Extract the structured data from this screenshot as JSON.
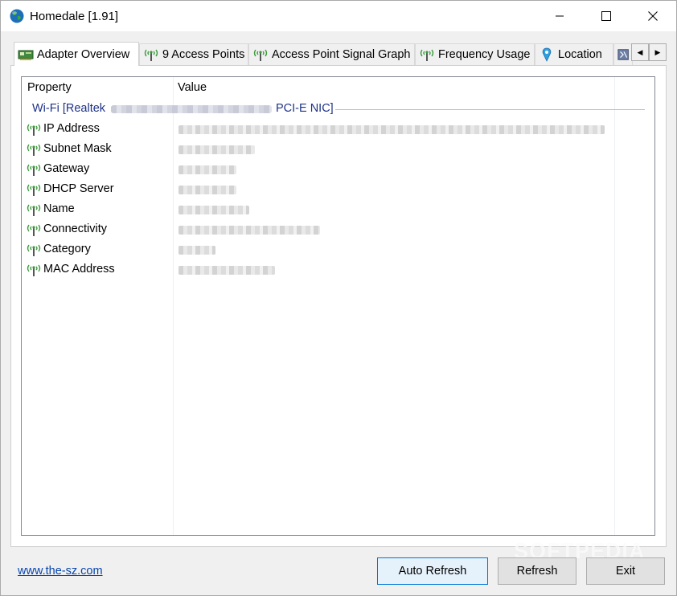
{
  "window": {
    "title": "Homedale [1.91]",
    "icon": "globe-icon"
  },
  "tabs": [
    {
      "label": "Adapter Overview",
      "icon": "network-card-icon",
      "active": true
    },
    {
      "label": "9 Access Points",
      "icon": "antenna-icon"
    },
    {
      "label": "Access Point Signal Graph",
      "icon": "antenna-icon"
    },
    {
      "label": "Frequency Usage",
      "icon": "antenna-icon"
    },
    {
      "label": "Location",
      "icon": "map-pin-icon"
    },
    {
      "label": "",
      "icon": "misc-tab-icon"
    }
  ],
  "tab_scroll": {
    "left_glyph": "◀",
    "right_glyph": "▶"
  },
  "list": {
    "columns": [
      "Property",
      "Value"
    ],
    "group": {
      "prefix": "Wi-Fi [Realtek",
      "suffix": "PCI-E NIC]"
    },
    "rows": [
      {
        "property": "IP Address",
        "icon": "antenna-icon"
      },
      {
        "property": "Subnet Mask",
        "icon": "antenna-icon"
      },
      {
        "property": "Gateway",
        "icon": "antenna-icon"
      },
      {
        "property": "DHCP Server",
        "icon": "antenna-icon"
      },
      {
        "property": "Name",
        "icon": "antenna-icon"
      },
      {
        "property": "Connectivity",
        "icon": "antenna-icon"
      },
      {
        "property": "Category",
        "icon": "antenna-icon"
      },
      {
        "property": "MAC Address",
        "icon": "antenna-icon"
      }
    ]
  },
  "footer": {
    "link": "www.the-sz.com",
    "auto_refresh": "Auto Refresh",
    "refresh": "Refresh",
    "exit": "Exit"
  },
  "watermark": "SOFTPEDIA",
  "colors": {
    "group_text": "#1e3287",
    "link": "#0645ad",
    "default_button_border": "#0078d7",
    "antenna_green": "#3c9a3c"
  }
}
